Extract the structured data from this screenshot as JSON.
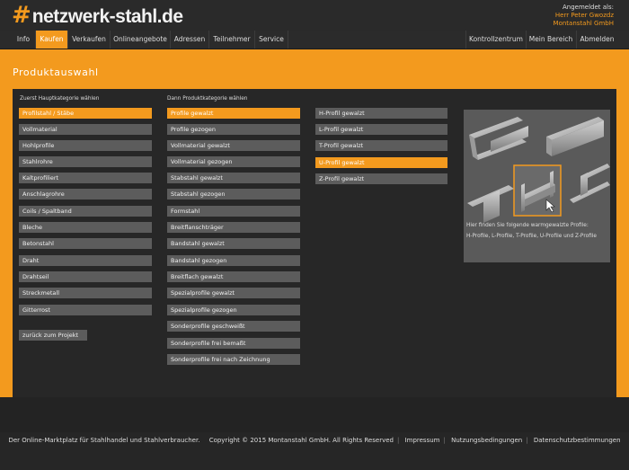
{
  "brand": {
    "hash": "#",
    "name": "netzwerk-stahl.de"
  },
  "user": {
    "status": "Angemeldet als:",
    "name": "Herr Peter Gwozdz",
    "company": "Montanstahl GmbH"
  },
  "nav": {
    "left": [
      "Info",
      "Kaufen",
      "Verkaufen",
      "Onlineangebote",
      "Adressen",
      "Teilnehmer",
      "Service"
    ],
    "right": [
      "Kontrollzentrum",
      "Mein Bereich",
      "Abmelden"
    ],
    "active": "Kaufen"
  },
  "page_title": "Produktauswahl",
  "main_categories": {
    "label": "Zuerst Hauptkategorie wählen",
    "items": [
      "Profilstahl / Stäbe",
      "Vollmaterial",
      "Hohlprofile",
      "Stahlrohre",
      "Kaltprofiliert",
      "Anschlagrohre",
      "Coils / Spaltband",
      "Bleche",
      "Betonstahl",
      "Draht",
      "Drahtseil",
      "Streckmetall",
      "Gitterrost"
    ],
    "selected": 0,
    "back_button": "zurück zum Projekt"
  },
  "product_categories": {
    "label": "Dann Produktkategorie wählen",
    "items": [
      "Profile gewalzt",
      "Profile gezogen",
      "Vollmaterial gewalzt",
      "Vollmaterial gezogen",
      "Stabstahl gewalzt",
      "Stabstahl gezogen",
      "Formstahl",
      "Breitflanschträger",
      "Bandstahl gewalzt",
      "Bandstahl gezogen",
      "Breitflach gewalzt",
      "Spezialprofile gewalzt",
      "Spezialprofile gezogen",
      "Sonderprofile geschweißt",
      "Sonderprofile frei bemaßt",
      "Sonderprofile frei nach Zeichnung"
    ],
    "selected": 0
  },
  "profiles": {
    "items": [
      "H-Profil gewalzt",
      "L-Profil gewalzt",
      "T-Profil gewalzt",
      "U-Profil gewalzt",
      "Z-Profil gewalzt"
    ],
    "selected": 3
  },
  "preview": {
    "intro": "Hier finden Sie folgende warmgewalzte Profile:",
    "list": "H-Profile, L-Profile, T-Profile, U-Profile und Z-Profile"
  },
  "footer": {
    "text": "Der Online-Marktplatz für Stahlhandel und Stahlverbraucher.",
    "copyright": "Copyright © 2015 Montanstahl GmbH. All Rights Reserved",
    "links": [
      "Impressum",
      "Nutzungsbedingungen",
      "Datenschutzbestimmungen"
    ]
  },
  "colors": {
    "accent": "#f39a1e",
    "panel": "#272727",
    "button": "#5c5c5c"
  }
}
